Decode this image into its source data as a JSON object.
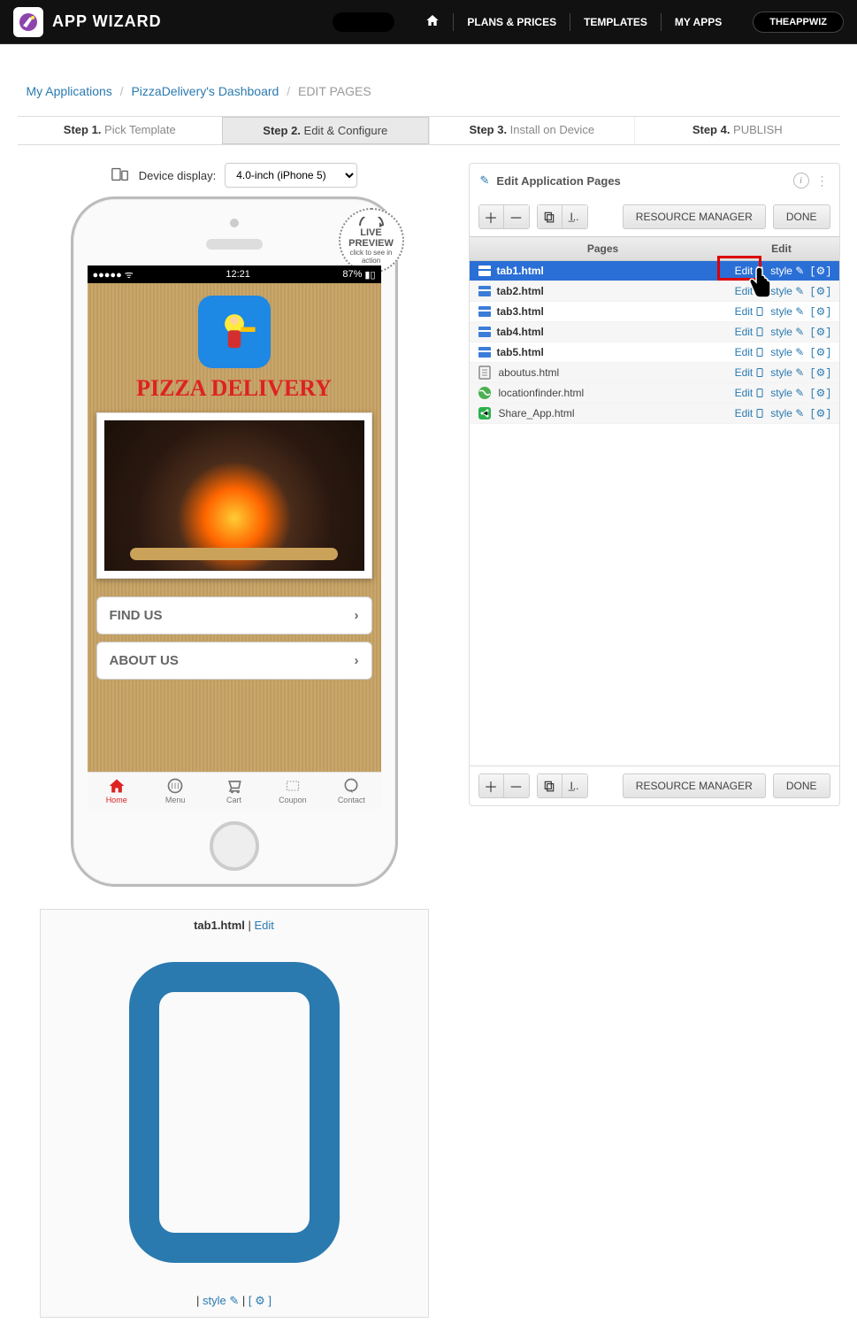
{
  "header": {
    "brand": "APP WIZARD",
    "links": [
      "PLANS & PRICES",
      "TEMPLATES",
      "MY APPS"
    ],
    "user": "THEAPPWIZ"
  },
  "breadcrumbs": {
    "a": "My Applications",
    "b": "PizzaDelivery's Dashboard",
    "current": "EDIT PAGES"
  },
  "steps": [
    {
      "bold": "Step 1.",
      "label": " Pick Template"
    },
    {
      "bold": "Step 2.",
      "label": " Edit & Configure"
    },
    {
      "bold": "Step 3.",
      "label": " Install on Device"
    },
    {
      "bold": "Step 4.",
      "label": " PUBLISH"
    }
  ],
  "device": {
    "label": "Device display:",
    "selected": "4.0-inch (iPhone 5)"
  },
  "badge": {
    "line1": "LIVE",
    "line2": "PREVIEW",
    "sub": "click to see in action"
  },
  "phone": {
    "time": "12:21",
    "battery": "87%",
    "appTitle": "PIZZA DELIVERY",
    "listItems": [
      "FIND US",
      "ABOUT US"
    ],
    "tabs": [
      "Home",
      "Menu",
      "Cart",
      "Coupon",
      "Contact"
    ]
  },
  "panel": {
    "title": "Edit Application Pages",
    "btnResource": "RESOURCE MANAGER",
    "btnDone": "DONE",
    "colPages": "Pages",
    "colEdit": "Edit",
    "editLabel": "Edit",
    "styleLabel": "style",
    "rows": [
      {
        "name": "tab1.html",
        "type": "tab",
        "sel": true
      },
      {
        "name": "tab2.html",
        "type": "tab"
      },
      {
        "name": "tab3.html",
        "type": "tab"
      },
      {
        "name": "tab4.html",
        "type": "tab"
      },
      {
        "name": "tab5.html",
        "type": "tab"
      },
      {
        "name": "aboutus.html",
        "type": "page"
      },
      {
        "name": "locationfinder.html",
        "type": "loc"
      },
      {
        "name": "Share_App.html",
        "type": "share"
      }
    ]
  },
  "footer": {
    "file": "tab1.html",
    "edit": "Edit",
    "style": "style"
  }
}
